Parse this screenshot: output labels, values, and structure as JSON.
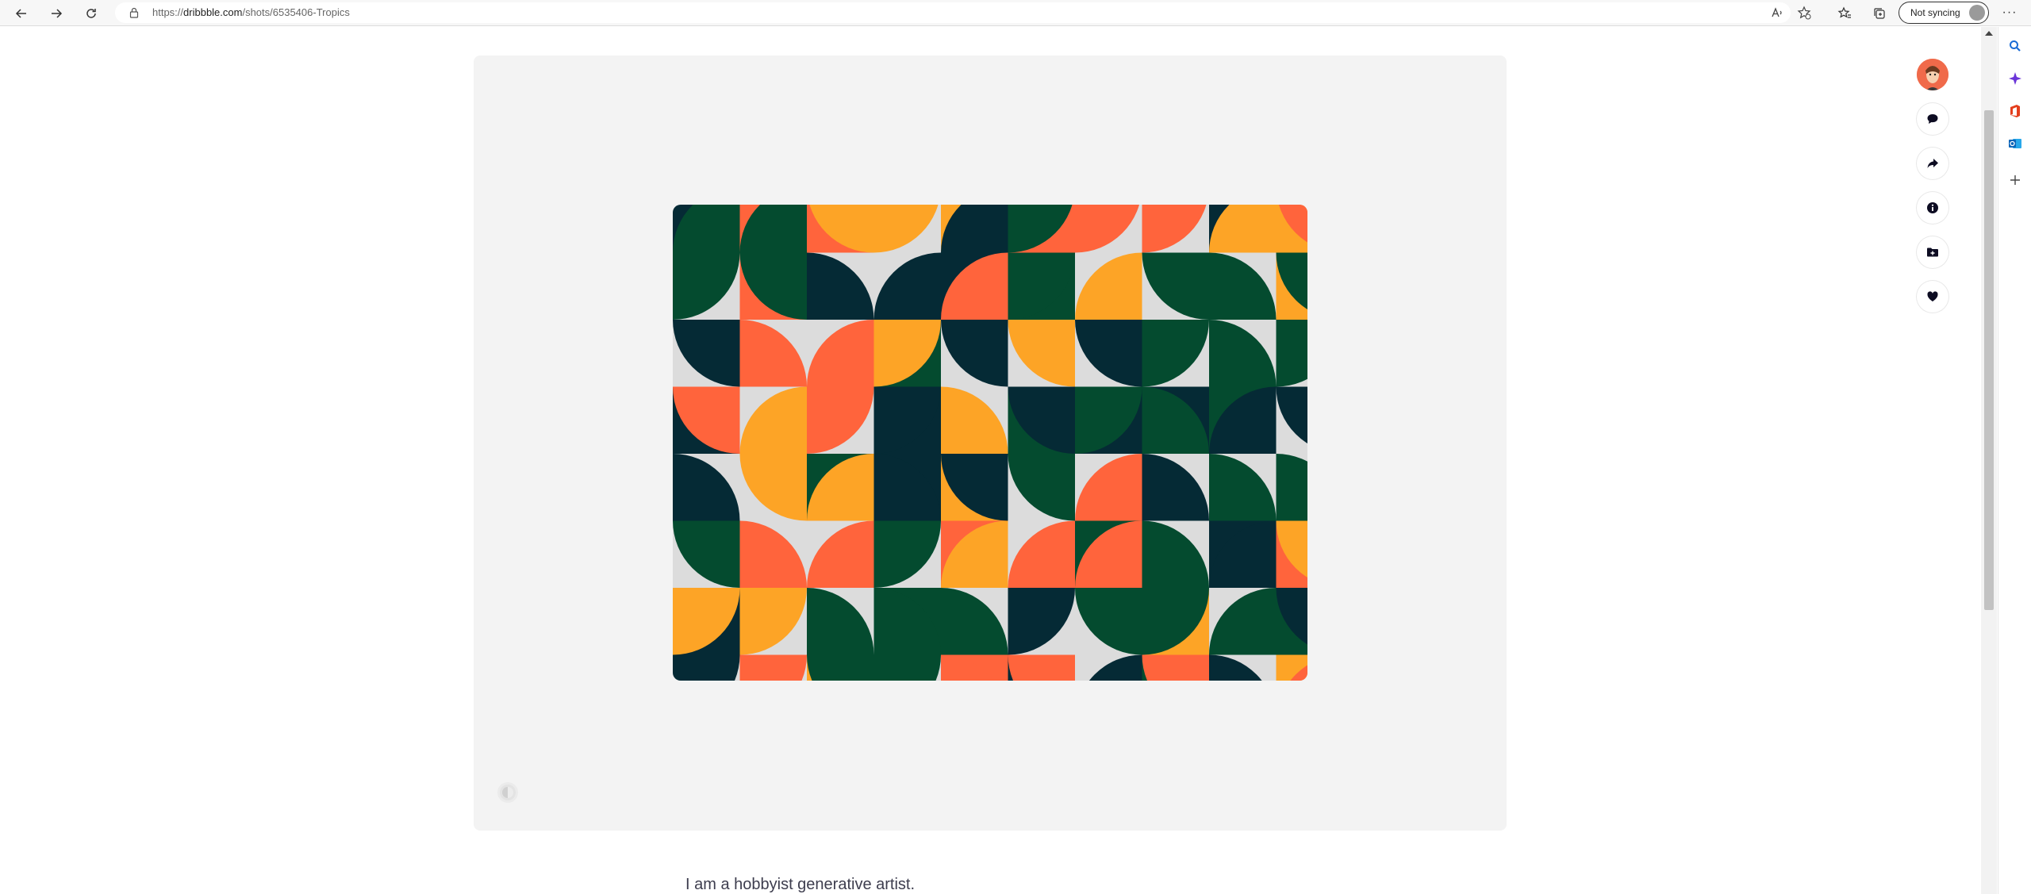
{
  "browser": {
    "url_prefix": "https://",
    "url_host": "dribbble.com",
    "url_path": "/shots/6535406-Tropics",
    "sync_label": "Not syncing",
    "more_label": "···"
  },
  "artwork": {
    "palette": {
      "navy": "#052a35",
      "green": "#044b2f",
      "yellow": "#fda426",
      "orange": "#ff643c",
      "gray": "#dcdcdc"
    }
  },
  "description": {
    "text": "I am a hobbyist generative artist."
  }
}
